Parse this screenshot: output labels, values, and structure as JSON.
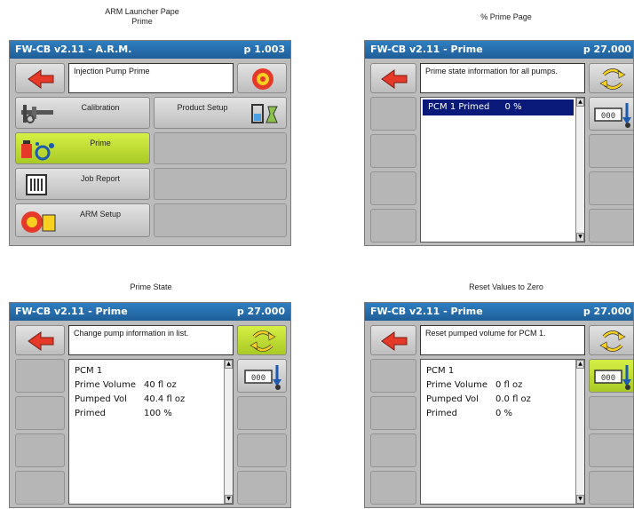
{
  "captions": {
    "launcher": [
      "ARM Launcher Pape",
      "Prime"
    ],
    "prime_page": "% Prime Page",
    "prime_state": "Prime State",
    "reset": "Reset Values to Zero"
  },
  "panel1": {
    "title": "FW-CB v2.11 - A.R.M.",
    "page": "p 1.003",
    "message": "Injection Pump Prime",
    "buttons": {
      "calibration": "Calibration",
      "product_setup": "Product Setup",
      "prime": "Prime",
      "job_report": "Job Report",
      "arm_setup": "ARM Setup"
    }
  },
  "panel2": {
    "title": "FW-CB v2.11 - Prime",
    "page": "p 27.000",
    "message": "Prime state information for all pumps.",
    "list": [
      {
        "name": "PCM 1 Primed",
        "value": "0 %"
      }
    ]
  },
  "panel3": {
    "title": "FW-CB v2.11 - Prime",
    "page": "p 27.000",
    "message": "Change pump information in list.",
    "pump": "PCM 1",
    "rows": [
      {
        "k": "Prime Volume",
        "v": "40 fl oz"
      },
      {
        "k": "Pumped Vol",
        "v": "40.4 fl oz"
      },
      {
        "k": "Primed",
        "v": "100 %"
      }
    ]
  },
  "panel4": {
    "title": "FW-CB v2.11 - Prime",
    "page": "p 27.000",
    "message": "Reset pumped volume for PCM 1.",
    "pump": "PCM 1",
    "rows": [
      {
        "k": "Prime Volume",
        "v": "0 fl oz"
      },
      {
        "k": "Pumped Vol",
        "v": "0.0 fl oz"
      },
      {
        "k": "Primed",
        "v": "0 %"
      }
    ]
  },
  "colors": {
    "titlebar": "#2f7fc1",
    "green_button": "#c6e33a",
    "list_selection": "#0a1a7a",
    "back_arrow": "#e53a2a"
  },
  "icons": [
    "back-arrow-icon",
    "stop-target-icon",
    "caliper-icon",
    "product-setup-icon",
    "prime-pump-icon",
    "job-report-icon",
    "arm-setup-icon",
    "refresh-arrows-icon",
    "reset-counter-icon"
  ]
}
